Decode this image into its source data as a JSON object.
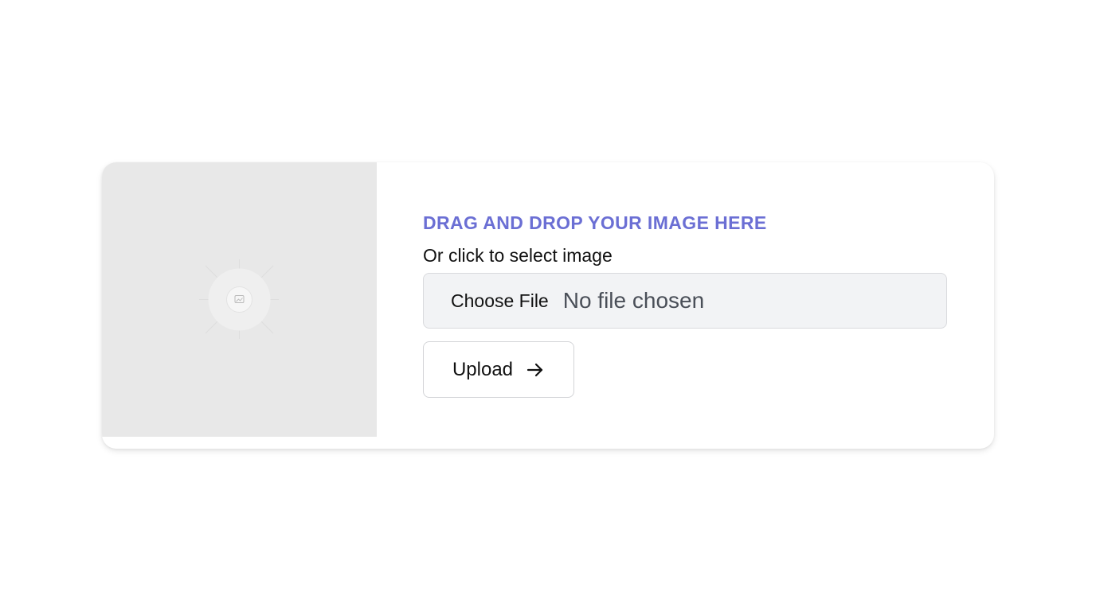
{
  "uploader": {
    "heading": "DRAG AND DROP YOUR IMAGE HERE",
    "subheading": "Or click to select image",
    "file_input": {
      "button_label": "Choose File",
      "status_text": "No file chosen"
    },
    "upload_button": {
      "label": "Upload",
      "icon": "arrow-right-icon"
    },
    "preview": {
      "icon": "image-placeholder-icon"
    }
  },
  "colors": {
    "accent": "#6b6fd4",
    "preview_bg": "#e8e8e8",
    "field_bg": "#f2f3f5"
  }
}
